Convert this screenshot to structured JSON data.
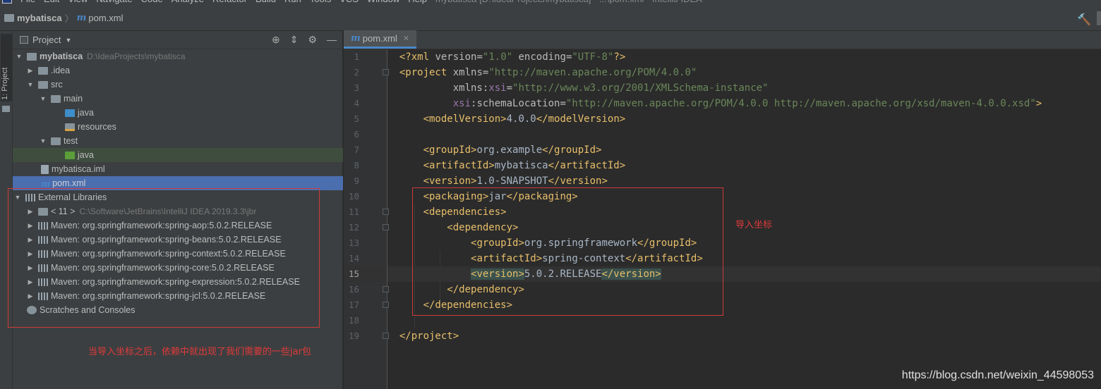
{
  "menubar": {
    "items": [
      "File",
      "Edit",
      "View",
      "Navigate",
      "Code",
      "Analyze",
      "Refactor",
      "Build",
      "Run",
      "Tools",
      "VCS",
      "Window",
      "Help"
    ],
    "title": "mybatisca [D:\\IdeaProjects\\mybatisca] - ...\\pom.xml - IntelliJ IDEA"
  },
  "navbar": {
    "project": "mybatisca",
    "file": "pom.xml"
  },
  "sidestripe": {
    "tab_label": "1: Project"
  },
  "project_panel": {
    "title": "Project",
    "tree": [
      {
        "label": "mybatisca",
        "path": "D:\\IdeaProjects\\mybatisca"
      },
      {
        "label": ".idea"
      },
      {
        "label": "src"
      },
      {
        "label": "main"
      },
      {
        "label": "java"
      },
      {
        "label": "resources"
      },
      {
        "label": "test"
      },
      {
        "label": "java"
      },
      {
        "label": "mybatisca.iml"
      },
      {
        "label": "pom.xml"
      },
      {
        "label": "External Libraries"
      },
      {
        "label": "< 11 >",
        "path": "C:\\Software\\JetBrains\\IntelliJ IDEA 2019.3.3\\jbr"
      },
      {
        "label": "Maven: org.springframework:spring-aop:5.0.2.RELEASE"
      },
      {
        "label": "Maven: org.springframework:spring-beans:5.0.2.RELEASE"
      },
      {
        "label": "Maven: org.springframework:spring-context:5.0.2.RELEASE"
      },
      {
        "label": "Maven: org.springframework:spring-core:5.0.2.RELEASE"
      },
      {
        "label": "Maven: org.springframework:spring-expression:5.0.2.RELEASE"
      },
      {
        "label": "Maven: org.springframework:spring-jcl:5.0.2.RELEASE"
      },
      {
        "label": "Scratches and Consoles"
      }
    ]
  },
  "annotations": {
    "left_note": "当导入坐标之后，依赖中就出现了我们需要的一些jar包",
    "right_note": "导入坐标",
    "red_color": "#e03a3a"
  },
  "editor": {
    "tab": "pom.xml",
    "current_line": 15,
    "line_numbers": [
      "1",
      "2",
      "3",
      "4",
      "5",
      "6",
      "7",
      "8",
      "9",
      "10",
      "11",
      "12",
      "13",
      "14",
      "15",
      "16",
      "17",
      "18",
      "19"
    ],
    "lines": {
      "l1": {
        "pi_open": "<?",
        "tag": "xml",
        "a1": "version",
        "v1": "\"1.0\"",
        "a2": "encoding",
        "v2": "\"UTF-8\"",
        "pi_close": "?>"
      },
      "l2": {
        "open": "<project",
        "a": "xmlns",
        "v": "\"http://maven.apache.org/POM/4.0.0\""
      },
      "l3": {
        "a": "xmlns",
        "ns": "xsi",
        "v": "\"http://www.w3.org/2001/XMLSchema-instance\""
      },
      "l4": {
        "ns": "xsi",
        "a": "schemaLocation",
        "v": "\"http://maven.apache.org/POM/4.0.0 http://maven.apache.org/xsd/maven-4.0.0.xsd\"",
        "close": ">"
      },
      "l5": {
        "open": "<modelVersion>",
        "text": "4.0.0",
        "close": "</modelVersion>"
      },
      "l7": {
        "open": "<groupId>",
        "text": "org.example",
        "close": "</groupId>"
      },
      "l8": {
        "open": "<artifactId>",
        "text": "mybatisca",
        "close": "</artifactId>"
      },
      "l9": {
        "open": "<version>",
        "text": "1.0-SNAPSHOT",
        "close": "</version>"
      },
      "l10": {
        "open": "<packaging>",
        "text": "jar",
        "close": "</packaging>"
      },
      "l11": {
        "open": "<dependencies>"
      },
      "l12": {
        "open": "<dependency>"
      },
      "l13": {
        "open": "<groupId>",
        "text": "org.springframework",
        "close": "</groupId>"
      },
      "l14": {
        "open": "<artifactId>",
        "text": "spring-context",
        "close": "</artifactId>"
      },
      "l15": {
        "open": "<version>",
        "text": "5.0.2.RELEASE",
        "close": "</version>"
      },
      "l16": {
        "close": "</dependency>"
      },
      "l17": {
        "close": "</dependencies>"
      },
      "l19": {
        "close": "</project>"
      }
    }
  },
  "watermark": "https://blog.csdn.net/weixin_44598053"
}
